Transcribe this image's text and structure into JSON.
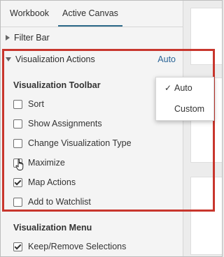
{
  "tabs": [
    {
      "label": "Workbook",
      "active": false
    },
    {
      "label": "Active Canvas",
      "active": true
    }
  ],
  "filter_bar": {
    "label": "Filter Bar",
    "expanded": false
  },
  "viz_actions": {
    "label": "Visualization Actions",
    "auto_label": "Auto",
    "expanded": true
  },
  "toolbar_group": {
    "title": "Visualization Toolbar",
    "items": [
      {
        "label": "Sort",
        "checked": false
      },
      {
        "label": "Show Assignments",
        "checked": false
      },
      {
        "label": "Change Visualization Type",
        "checked": false
      },
      {
        "label": "Maximize",
        "checked": false
      },
      {
        "label": "Map Actions",
        "checked": true
      },
      {
        "label": "Add to Watchlist",
        "checked": false
      }
    ]
  },
  "menu_group": {
    "title": "Visualization Menu",
    "items": [
      {
        "label": "Keep/Remove Selections",
        "checked": true
      }
    ]
  },
  "popup": {
    "options": [
      {
        "label": "Auto",
        "selected": true,
        "check_glyph": "✓"
      },
      {
        "label": "Custom",
        "selected": false,
        "check_glyph": ""
      }
    ]
  },
  "colors": {
    "accent": "#2a6496",
    "highlight": "#c8362d"
  }
}
